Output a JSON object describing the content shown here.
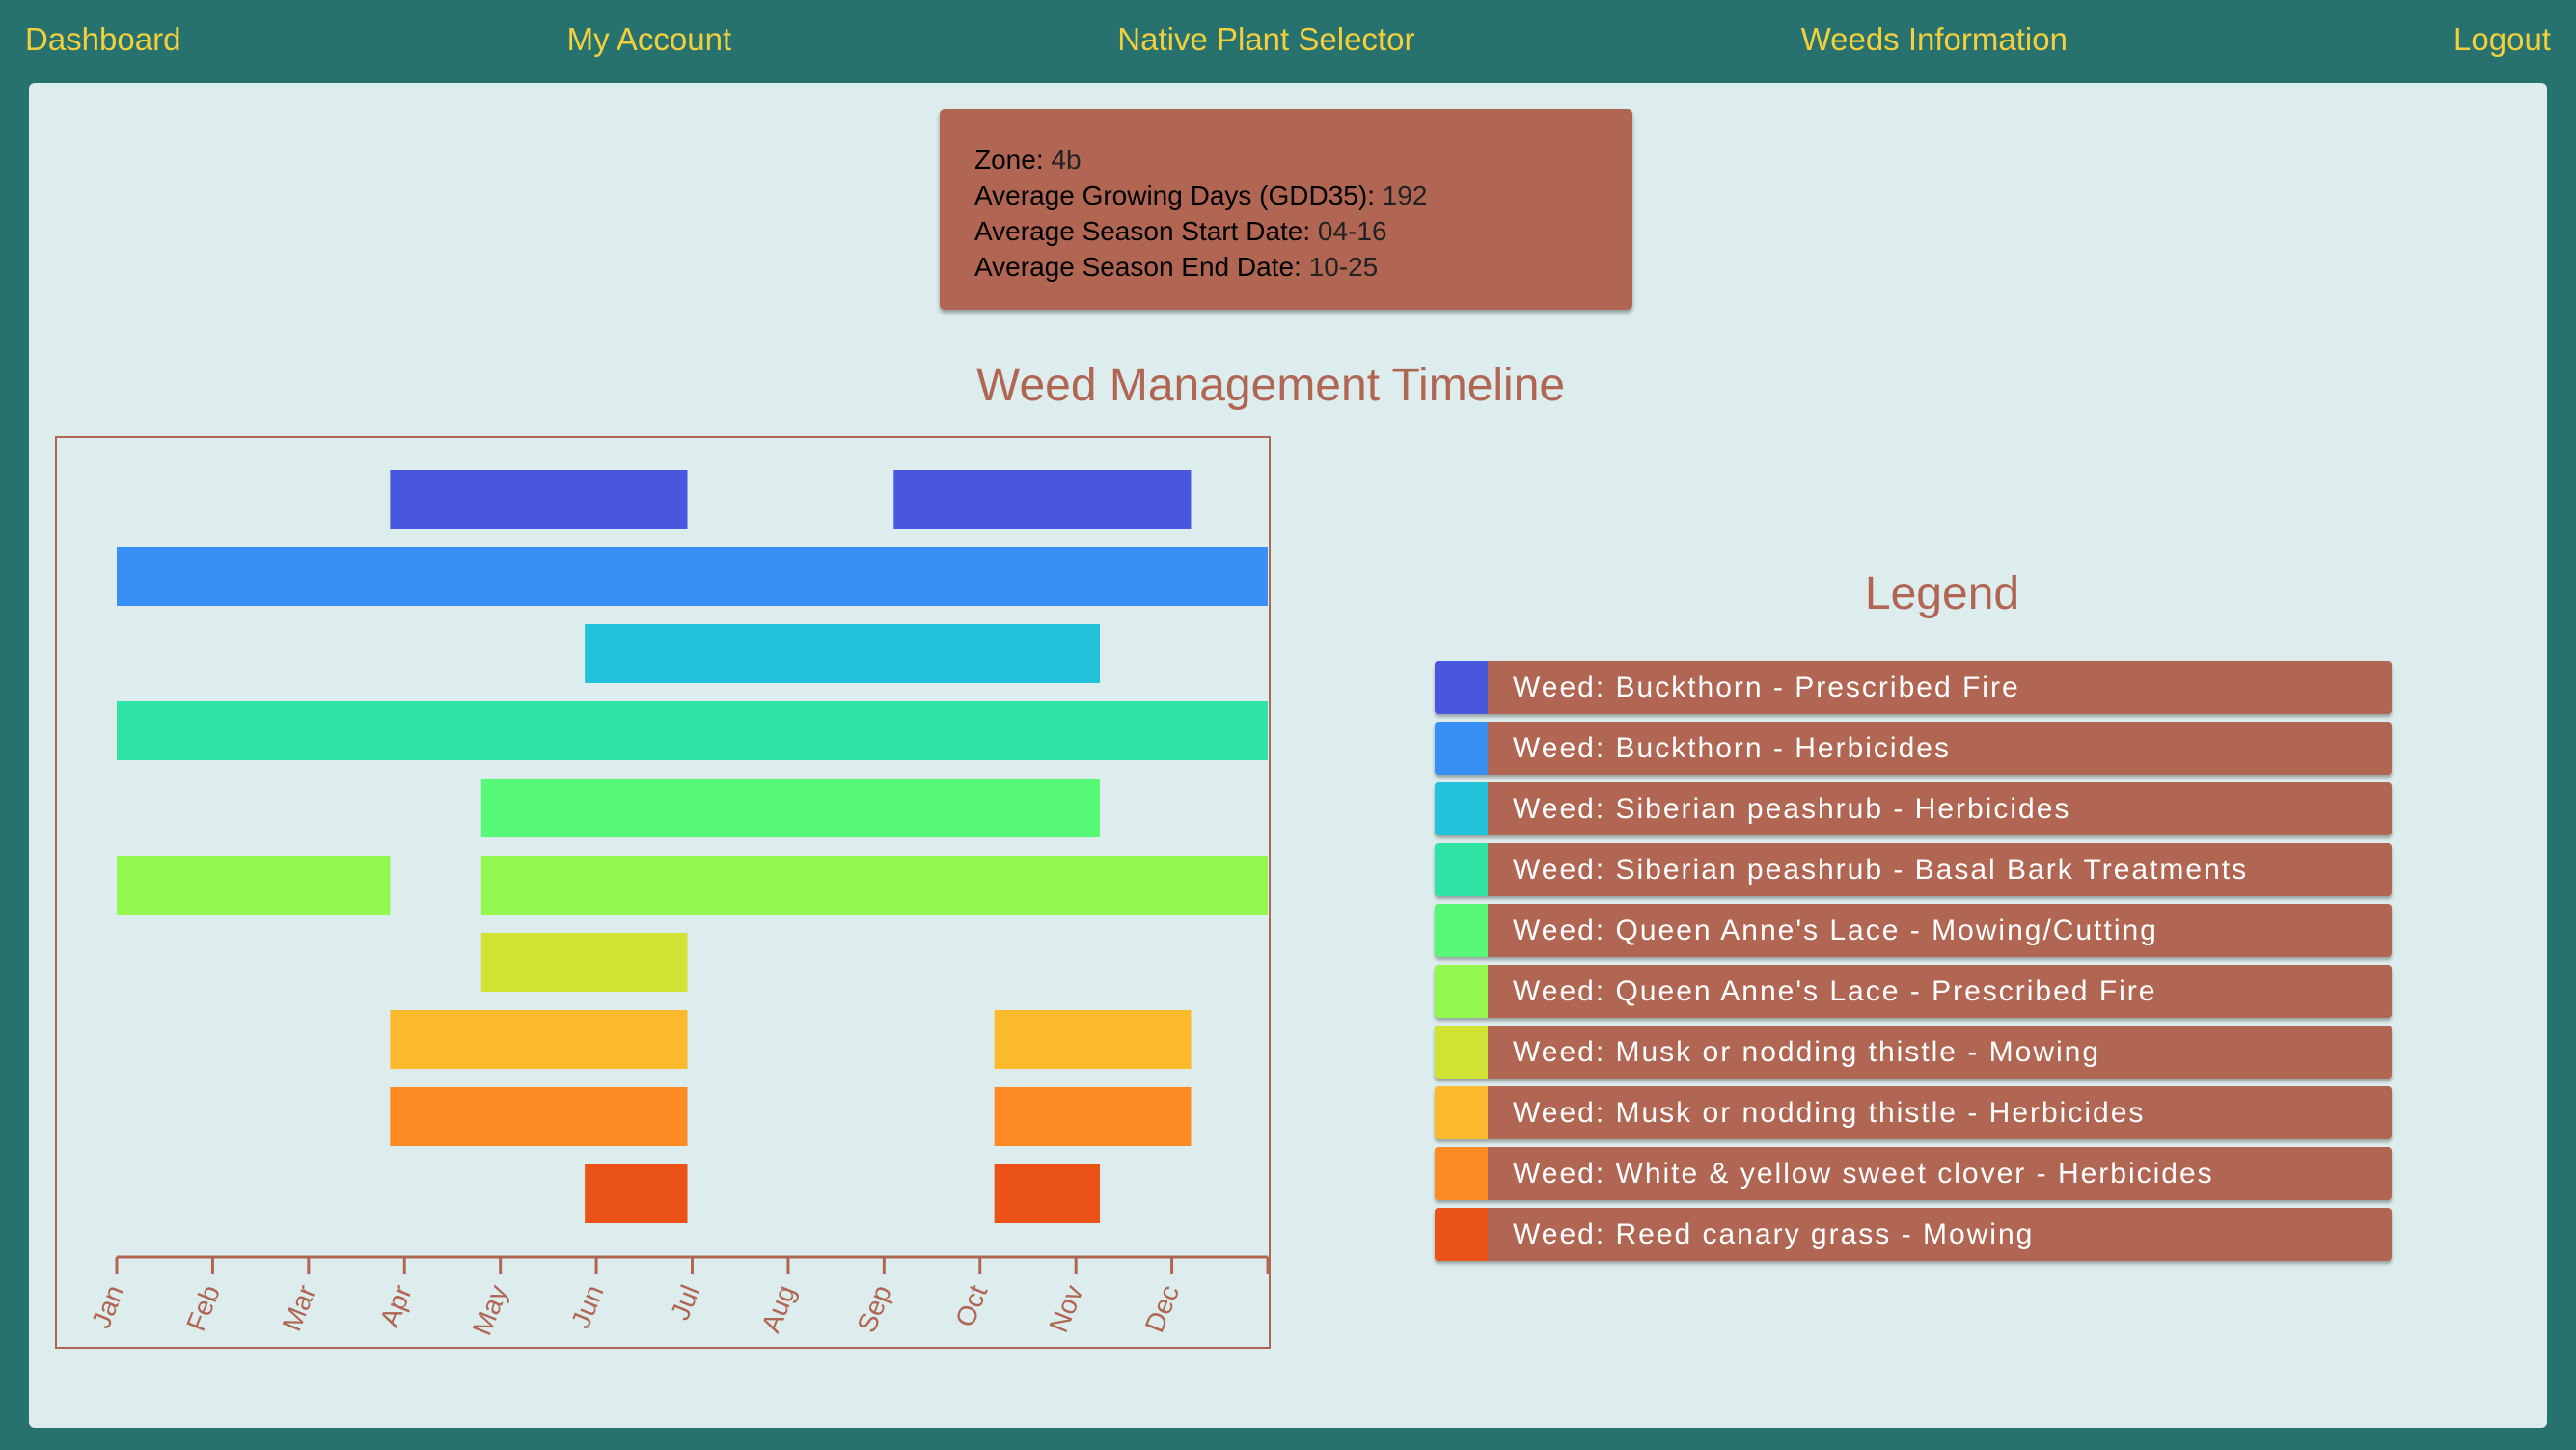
{
  "nav": {
    "dashboard": "Dashboard",
    "account": "My Account",
    "selector": "Native Plant Selector",
    "weeds": "Weeds Information",
    "logout": "Logout"
  },
  "zone": {
    "zone_label": "Zone:",
    "zone_value": "4b",
    "gdd_label": "Average Growing Days (GDD35):",
    "gdd_value": "192",
    "start_label": "Average Season Start Date:",
    "start_value": "04-16",
    "end_label": "Average Season End Date:",
    "end_value": "10-25"
  },
  "legend_title": "Legend",
  "colors": {
    "background": "#27726f",
    "panel": "#ddecec",
    "accent": "#b06652",
    "nav_text": "#f2cf3c"
  },
  "chart_data": {
    "type": "bar",
    "title": "Weed Management Timeline",
    "x_ticks": [
      "Jan",
      "Feb",
      "Mar",
      "Apr",
      "May",
      "Jun",
      "Jul",
      "Aug",
      "Sep",
      "Oct",
      "Nov",
      "Dec"
    ],
    "xlim": [
      0,
      12
    ],
    "series": [
      {
        "name": "Weed: Buckthorn - Prescribed Fire",
        "color": "#4857de",
        "ranges": [
          [
            2.85,
            5.95
          ],
          [
            8.1,
            11.2
          ]
        ]
      },
      {
        "name": "Weed: Buckthorn - Herbicides",
        "color": "#3890f5",
        "ranges": [
          [
            0.0,
            12.0
          ]
        ]
      },
      {
        "name": "Weed: Siberian peashrub - Herbicides",
        "color": "#24c3dc",
        "ranges": [
          [
            4.88,
            10.25
          ]
        ]
      },
      {
        "name": "Weed: Siberian peashrub - Basal Bark Treatments",
        "color": "#2fe4a4",
        "ranges": [
          [
            0.0,
            12.0
          ]
        ]
      },
      {
        "name": "Weed: Queen Anne's Lace - Mowing/Cutting",
        "color": "#58f877",
        "ranges": [
          [
            3.8,
            10.25
          ]
        ]
      },
      {
        "name": "Weed: Queen Anne's Lace - Prescribed Fire",
        "color": "#93f84d",
        "ranges": [
          [
            0.0,
            2.85
          ],
          [
            3.8,
            12.0
          ]
        ]
      },
      {
        "name": "Weed: Musk or nodding thistle - Mowing",
        "color": "#d0e234",
        "ranges": [
          [
            3.8,
            5.95
          ]
        ]
      },
      {
        "name": "Weed: Musk or nodding thistle - Herbicides",
        "color": "#fbba2b",
        "ranges": [
          [
            2.85,
            5.95
          ],
          [
            9.15,
            11.2
          ]
        ]
      },
      {
        "name": "Weed: White & yellow sweet clover - Herbicides",
        "color": "#fd8a22",
        "ranges": [
          [
            2.85,
            5.95
          ],
          [
            9.15,
            11.2
          ]
        ]
      },
      {
        "name": "Weed: Reed canary grass - Mowing",
        "color": "#ea5217",
        "ranges": [
          [
            4.88,
            5.95
          ],
          [
            9.15,
            10.25
          ]
        ]
      }
    ]
  }
}
